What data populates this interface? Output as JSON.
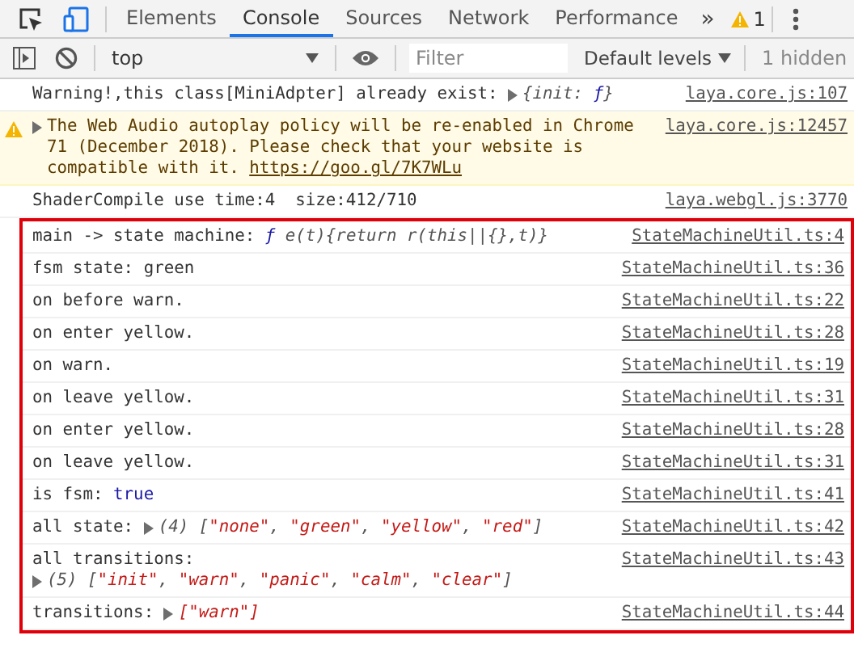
{
  "tabs": [
    {
      "label": "Elements",
      "selected": false
    },
    {
      "label": "Console",
      "selected": true
    },
    {
      "label": "Sources",
      "selected": false
    },
    {
      "label": "Network",
      "selected": false
    },
    {
      "label": "Performance",
      "selected": false
    }
  ],
  "more_tabs": "»",
  "warning_count": "1",
  "toolbar": {
    "context": "top",
    "filter_placeholder": "Filter",
    "levels": "Default levels",
    "hidden": "1 hidden"
  },
  "messages": [
    {
      "kind": "log",
      "text": "Warning!,this class[MiniAdpter] already exist: ",
      "toggle": true,
      "value": [
        {
          "kind": "object",
          "text": "{init: "
        },
        {
          "kind": "function",
          "text": "ƒ"
        },
        {
          "kind": "object",
          "text": "}"
        }
      ],
      "source": "laya.core.js:107"
    },
    {
      "kind": "warning",
      "toggle": true,
      "text": "The Web Audio autoplay policy will be re-enabled in Chrome 71 (December 2018). Please check that your website is compatible with it. ",
      "link": "https://goo.gl/7K7WLu",
      "source": "laya.core.js:12457"
    },
    {
      "kind": "log",
      "text": "ShaderCompile use time:4  size:412/710",
      "source": "laya.webgl.js:3770"
    }
  ],
  "highlighted_messages": [
    {
      "kind": "log",
      "text": "main -> state machine: ",
      "value": [
        {
          "kind": "function",
          "text": "ƒ "
        },
        {
          "kind": "object",
          "text": "e(t){return r(this||{},t)}"
        }
      ],
      "source": "StateMachineUtil.ts:4"
    },
    {
      "kind": "log",
      "text": "fsm state: green",
      "source": "StateMachineUtil.ts:36"
    },
    {
      "kind": "log",
      "text": "on before warn.",
      "source": "StateMachineUtil.ts:22"
    },
    {
      "kind": "log",
      "text": "on enter yellow.",
      "source": "StateMachineUtil.ts:28"
    },
    {
      "kind": "log",
      "text": "on warn.",
      "source": "StateMachineUtil.ts:19"
    },
    {
      "kind": "log",
      "text": "on leave yellow.",
      "source": "StateMachineUtil.ts:31"
    },
    {
      "kind": "log",
      "text": "on enter yellow.",
      "source": "StateMachineUtil.ts:28"
    },
    {
      "kind": "log",
      "text": "on leave yellow.",
      "source": "StateMachineUtil.ts:31"
    },
    {
      "kind": "log",
      "text": "is fsm: ",
      "value": [
        {
          "kind": "boolean",
          "text": "true"
        }
      ],
      "source": "StateMachineUtil.ts:41"
    },
    {
      "kind": "log",
      "text": "all state: ",
      "toggle": true,
      "value": [
        {
          "kind": "object",
          "text": "(4) ["
        },
        {
          "kind": "string",
          "text": "\"none\""
        },
        {
          "kind": "object",
          "text": ", "
        },
        {
          "kind": "string",
          "text": "\"green\""
        },
        {
          "kind": "object",
          "text": ", "
        },
        {
          "kind": "string",
          "text": "\"yellow\""
        },
        {
          "kind": "object",
          "text": ", "
        },
        {
          "kind": "string",
          "text": "\"red\""
        },
        {
          "kind": "object",
          "text": "]"
        }
      ],
      "source": "StateMachineUtil.ts:42"
    },
    {
      "kind": "wrapped",
      "text": "all transitions:",
      "toggle": true,
      "value": [
        {
          "kind": "object",
          "text": "(5) ["
        },
        {
          "kind": "string",
          "text": "\"init\""
        },
        {
          "kind": "object",
          "text": ", "
        },
        {
          "kind": "string",
          "text": "\"warn\""
        },
        {
          "kind": "object",
          "text": ", "
        },
        {
          "kind": "string",
          "text": "\"panic\""
        },
        {
          "kind": "object",
          "text": ", "
        },
        {
          "kind": "string",
          "text": "\"calm\""
        },
        {
          "kind": "object",
          "text": ", "
        },
        {
          "kind": "string",
          "text": "\"clear\""
        },
        {
          "kind": "object",
          "text": "]"
        }
      ],
      "source": "StateMachineUtil.ts:43"
    },
    {
      "kind": "log",
      "text": "transitions: ",
      "toggle": true,
      "value": [
        {
          "kind": "string",
          "text": "[\"warn\"]"
        }
      ],
      "source": "StateMachineUtil.ts:44"
    }
  ]
}
